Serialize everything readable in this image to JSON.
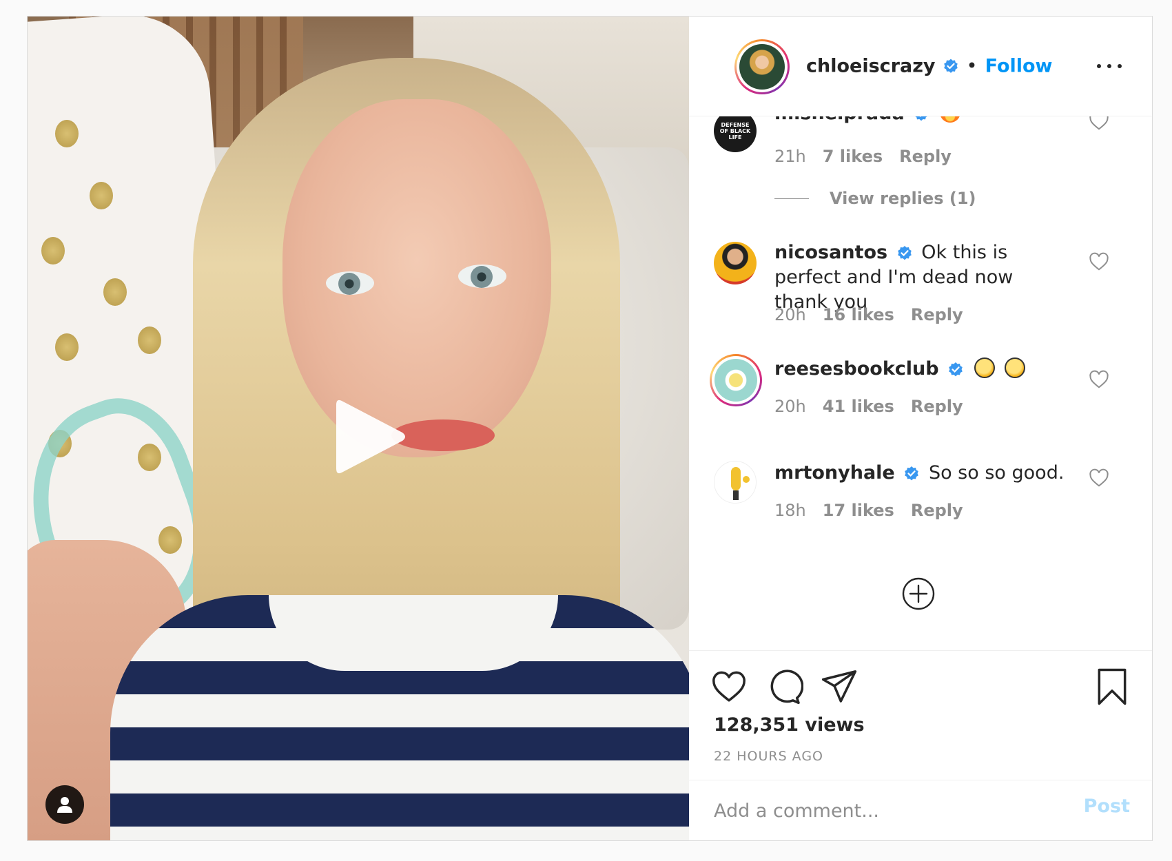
{
  "header": {
    "username": "chloeiscrazy",
    "separator": "•",
    "follow_label": "Follow",
    "more_icon": "more-horizontal-icon"
  },
  "comments": [
    {
      "username": "misheiprada",
      "text": "",
      "time": "21h",
      "likes": "7 likes",
      "reply_label": "Reply",
      "view_replies": "View replies (1)",
      "avatar_text": "DEFENSE OF BLACK LIFE",
      "emoji": [
        "fire"
      ]
    },
    {
      "username": "nicosantos",
      "text": "Ok this is perfect and I'm dead now thank you",
      "time": "20h",
      "likes": "16 likes",
      "reply_label": "Reply"
    },
    {
      "username": "reesesbookclub",
      "text": "",
      "time": "20h",
      "likes": "41 likes",
      "reply_label": "Reply",
      "emoji": [
        "rofl",
        "rofl"
      ]
    },
    {
      "username": "mrtonyhale",
      "text": "So so so good.",
      "time": "18h",
      "likes": "17 likes",
      "reply_label": "Reply"
    }
  ],
  "actions": {
    "views": "128,351 views",
    "time_ago": "22 HOURS AGO"
  },
  "add_comment": {
    "placeholder": "Add a comment...",
    "post_label": "Post"
  },
  "colors": {
    "link": "#0095f6",
    "muted": "#8e8e8e",
    "post_disabled": "#b2dffc",
    "verified": "#3897f0"
  }
}
